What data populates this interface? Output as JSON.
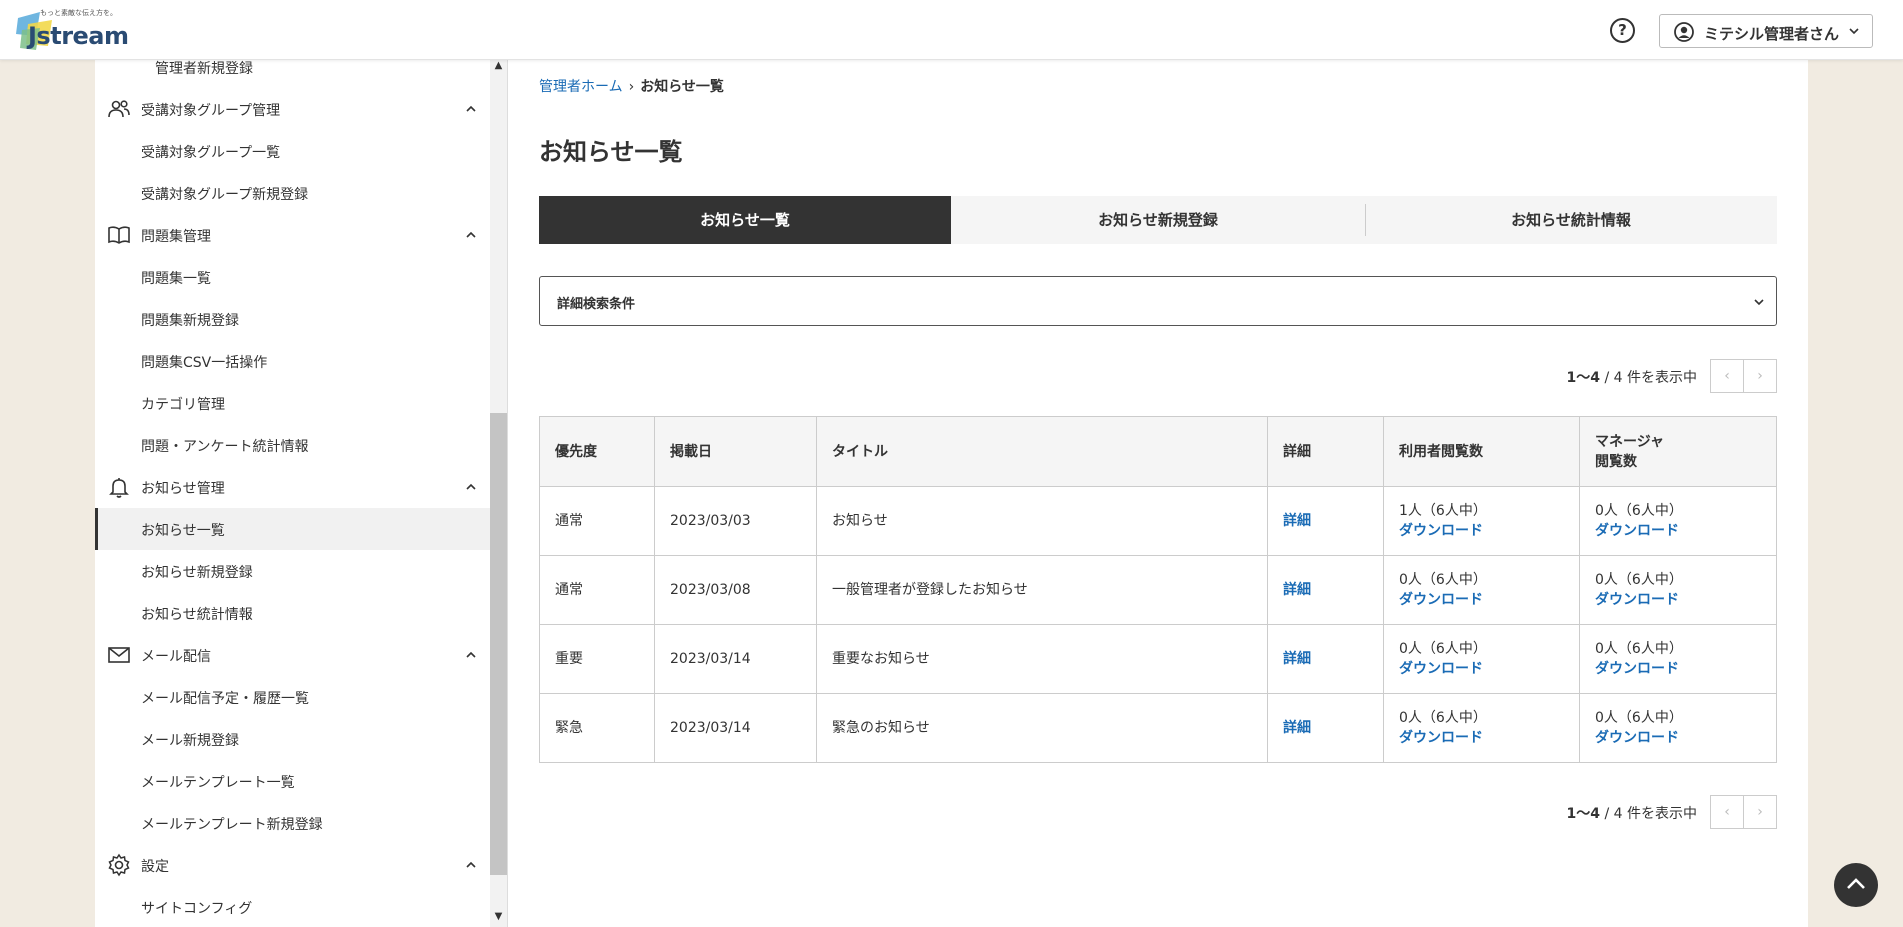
{
  "header": {
    "logo_tagline": "もっと素敵な伝え方を。",
    "logo_text": "Jstream",
    "help_label": "?",
    "user_name": "ミテシル管理者さん"
  },
  "sidebar": {
    "items": [
      {
        "label": "管理者新規登録",
        "type": "sub"
      },
      {
        "label": "受講対象グループ管理",
        "type": "section",
        "icon": "users-icon"
      },
      {
        "label": "受講対象グループ一覧",
        "type": "sub"
      },
      {
        "label": "受講対象グループ新規登録",
        "type": "sub"
      },
      {
        "label": "問題集管理",
        "type": "section",
        "icon": "book-icon"
      },
      {
        "label": "問題集一覧",
        "type": "sub"
      },
      {
        "label": "問題集新規登録",
        "type": "sub"
      },
      {
        "label": "問題集CSV一括操作",
        "type": "sub"
      },
      {
        "label": "カテゴリ管理",
        "type": "sub"
      },
      {
        "label": "問題・アンケート統計情報",
        "type": "sub"
      },
      {
        "label": "お知らせ管理",
        "type": "section",
        "icon": "bell-icon"
      },
      {
        "label": "お知らせ一覧",
        "type": "sub",
        "active": true
      },
      {
        "label": "お知らせ新規登録",
        "type": "sub"
      },
      {
        "label": "お知らせ統計情報",
        "type": "sub"
      },
      {
        "label": "メール配信",
        "type": "section",
        "icon": "mail-icon"
      },
      {
        "label": "メール配信予定・履歴一覧",
        "type": "sub"
      },
      {
        "label": "メール新規登録",
        "type": "sub"
      },
      {
        "label": "メールテンプレート一覧",
        "type": "sub"
      },
      {
        "label": "メールテンプレート新規登録",
        "type": "sub"
      },
      {
        "label": "設定",
        "type": "section",
        "icon": "gear-icon"
      },
      {
        "label": "サイトコンフィグ",
        "type": "sub"
      }
    ]
  },
  "breadcrumb": {
    "home": "管理者ホーム",
    "current": "お知らせ一覧"
  },
  "page_title": "お知らせ一覧",
  "tabs": [
    "お知らせ一覧",
    "お知らせ新規登録",
    "お知らせ統計情報"
  ],
  "search": {
    "label": "詳細検索条件"
  },
  "pager": {
    "range": "1〜4",
    "suffix": " / 4 件を表示中",
    "prev": "‹",
    "next": "›"
  },
  "table": {
    "headers": [
      "優先度",
      "掲載日",
      "タイトル",
      "詳細",
      "利用者閲覧数",
      "マネージャ\n閲覧数"
    ],
    "rows": [
      {
        "priority": "通常",
        "date": "2023/03/03",
        "title": "お知らせ",
        "detail": "詳細",
        "user_views": "1人（6人中）",
        "user_dl": "ダウンロード",
        "mgr_views": "0人（6人中）",
        "mgr_dl": "ダウンロード"
      },
      {
        "priority": "通常",
        "date": "2023/03/08",
        "title": "一般管理者が登録したお知らせ",
        "detail": "詳細",
        "user_views": "0人（6人中）",
        "user_dl": "ダウンロード",
        "mgr_views": "0人（6人中）",
        "mgr_dl": "ダウンロード"
      },
      {
        "priority": "重要",
        "date": "2023/03/14",
        "title": "重要なお知らせ",
        "detail": "詳細",
        "user_views": "0人（6人中）",
        "user_dl": "ダウンロード",
        "mgr_views": "0人（6人中）",
        "mgr_dl": "ダウンロード"
      },
      {
        "priority": "緊急",
        "date": "2023/03/14",
        "title": "緊急のお知らせ",
        "detail": "詳細",
        "user_views": "0人（6人中）",
        "user_dl": "ダウンロード",
        "mgr_views": "0人（6人中）",
        "mgr_dl": "ダウンロード"
      }
    ]
  },
  "colors": {
    "accent": "#1a6bb5",
    "dark": "#333333",
    "page_bg": "#f1ebe1"
  }
}
